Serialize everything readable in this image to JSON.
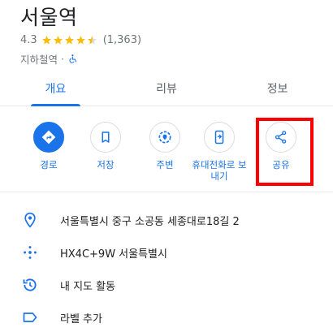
{
  "place": {
    "title": "서울역",
    "rating": "4.3",
    "review_count": "(1,363)",
    "category": "지하철역",
    "separator": "·"
  },
  "tabs": [
    {
      "label": "개요",
      "active": true
    },
    {
      "label": "리뷰",
      "active": false
    },
    {
      "label": "정보",
      "active": false
    }
  ],
  "actions": [
    {
      "label": "경로",
      "icon": "directions-icon"
    },
    {
      "label": "저장",
      "icon": "bookmark-icon"
    },
    {
      "label": "주변",
      "icon": "nearby-icon"
    },
    {
      "label": "휴대전화로 보내기",
      "icon": "send-to-phone-icon"
    },
    {
      "label": "공유",
      "icon": "share-icon"
    }
  ],
  "info": [
    {
      "text": "서울특별시 중구 소공동 세종대로18길 2",
      "icon": "location-pin-icon"
    },
    {
      "text": "HX4C+9W 서울특별시",
      "icon": "plus-code-icon"
    },
    {
      "text": "내 지도 활동",
      "icon": "history-icon"
    },
    {
      "text": "라벨 추가",
      "icon": "label-icon"
    }
  ],
  "colors": {
    "accent": "#1a73e8",
    "star": "#fbbc04",
    "highlight": "#ff0000"
  }
}
